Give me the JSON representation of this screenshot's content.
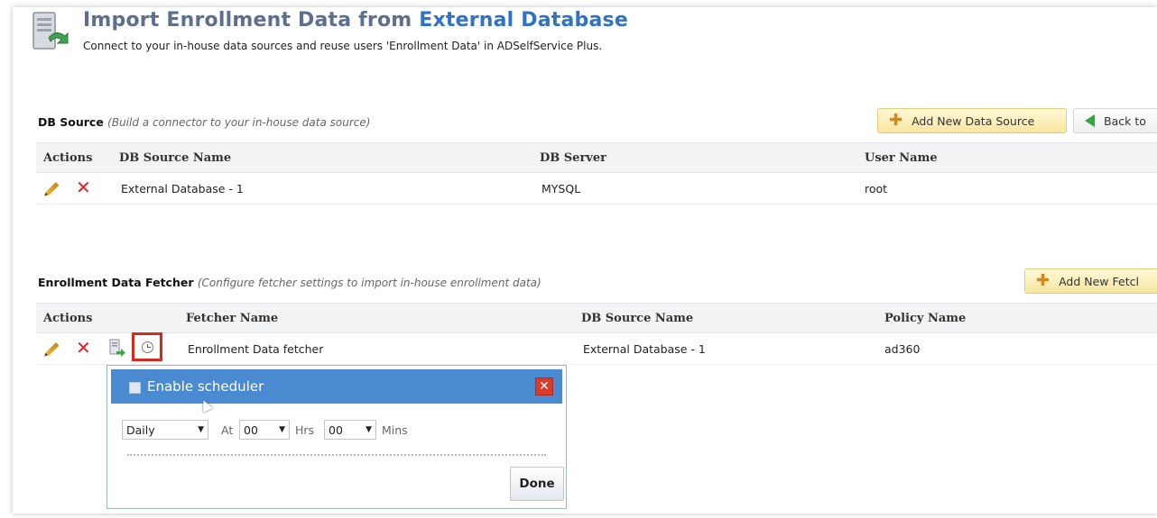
{
  "header": {
    "title_main": "Import Enrollment Data from",
    "title_accent": "External Database",
    "subtitle": "Connect to your in-house data sources and reuse users 'Enrollment Data' in ADSelfService Plus.",
    "icon": "server-import-icon"
  },
  "db_source": {
    "title": "DB Source",
    "hint": "(Build a connector to your in-house data source)",
    "add_button": "Add New Data Source",
    "back_button": "Back to",
    "columns": [
      "Actions",
      "DB Source Name",
      "DB Server",
      "User Name"
    ],
    "rows": [
      {
        "name": "External Database - 1",
        "server": "MYSQL",
        "user": "root"
      }
    ]
  },
  "fetcher": {
    "title": "Enrollment Data Fetcher",
    "hint": "(Configure fetcher settings to import in-house enrollment data)",
    "add_button": "Add New Fetcl",
    "columns": [
      "Actions",
      "Fetcher Name",
      "DB Source Name",
      "Policy Name"
    ],
    "rows": [
      {
        "name": "Enrollment Data fetcher",
        "source": "External Database - 1",
        "policy": "ad360"
      }
    ]
  },
  "scheduler": {
    "label": "Enable scheduler",
    "frequency": "Daily",
    "at_label": "At",
    "hours": "00",
    "hrs_label": "Hrs",
    "minutes": "00",
    "mins_label": "Mins",
    "done_label": "Done"
  },
  "colors": {
    "title": "#5c6f8e",
    "accent": "#2f73c2",
    "popup_header": "#4a8ad0",
    "highlight": "#d52a20",
    "delete": "#d82424"
  }
}
